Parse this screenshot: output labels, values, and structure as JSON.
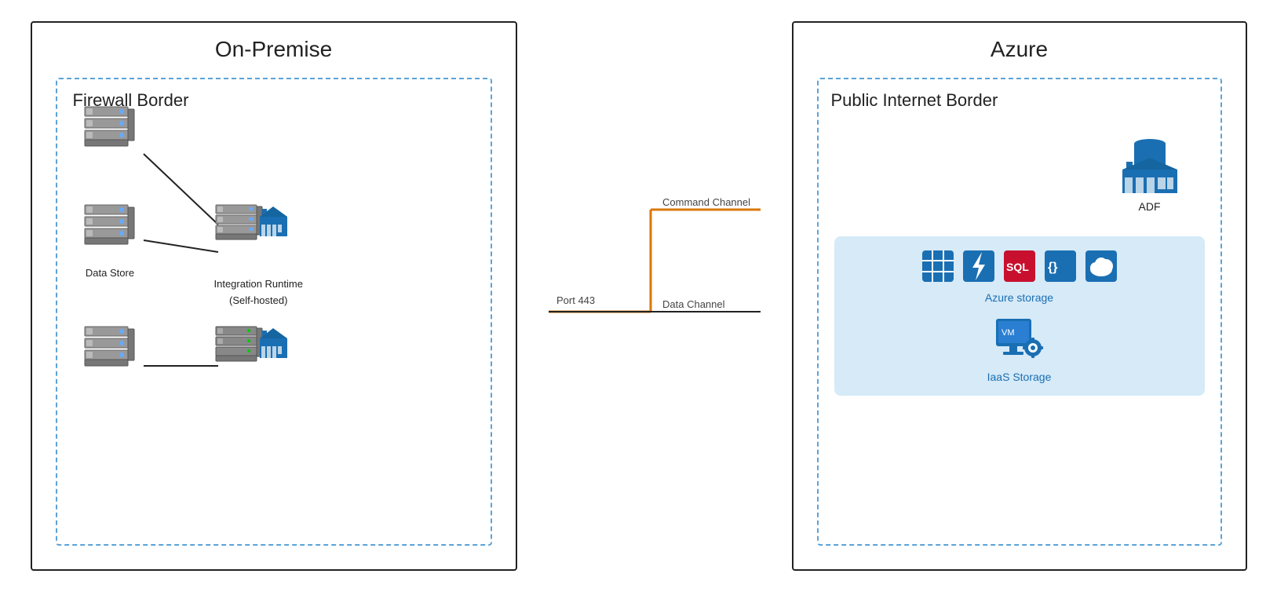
{
  "onPremise": {
    "title": "On-Premise",
    "firewallBorder": {
      "title": "Firewall Border"
    },
    "dataStore": {
      "label": "Data Store"
    },
    "integrationRuntime": {
      "label1": "Integration Runtime",
      "label2": "(Self-hosted)"
    }
  },
  "azure": {
    "title": "Azure",
    "publicInternetBorder": {
      "title": "Public Internet Border"
    },
    "adf": {
      "label": "ADF"
    },
    "azureStorage": {
      "label": "Azure storage"
    },
    "iaasStorage": {
      "label": "IaaS Storage"
    }
  },
  "channels": {
    "commandChannel": "Command Channel",
    "dataChannel": "Data Channel",
    "port": "Port 443"
  }
}
